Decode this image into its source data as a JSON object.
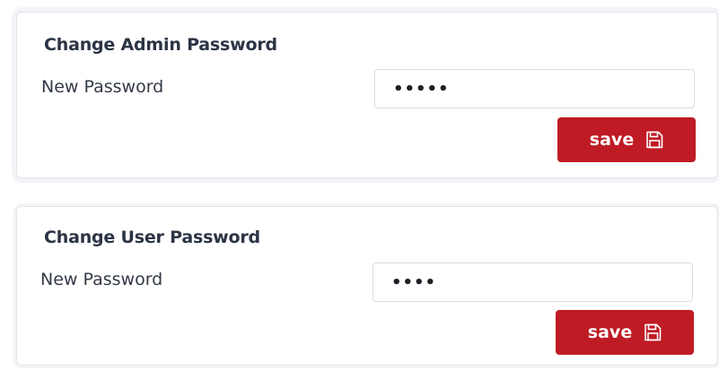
{
  "colors": {
    "accent": "#bf1b24",
    "title_text": "#2b3444",
    "panel_border": "#e3e5ea"
  },
  "admin_password": {
    "title": "Change Admin Password",
    "field_label": "New Password",
    "input_value": "•••••",
    "save_label": "save",
    "save_icon": "floppy-disk-icon"
  },
  "user_password": {
    "title": "Change User Password",
    "field_label": "New Password",
    "input_value": "••••",
    "save_label": "save",
    "save_icon": "floppy-disk-icon"
  }
}
